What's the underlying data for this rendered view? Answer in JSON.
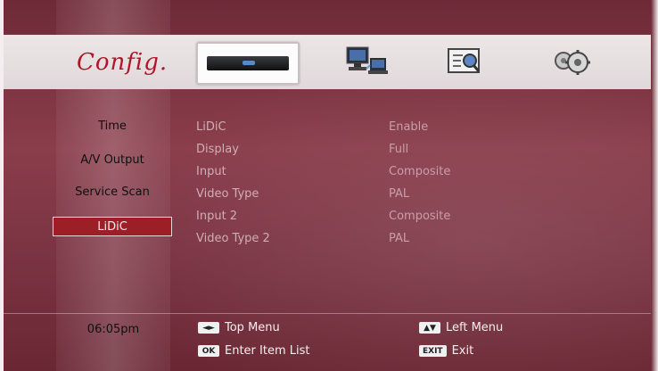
{
  "header": {
    "title": "Config.",
    "tabs": [
      {
        "name": "receiver",
        "icon": "receiver-icon"
      },
      {
        "name": "network",
        "icon": "network-computer-icon"
      },
      {
        "name": "information",
        "icon": "info-search-icon"
      },
      {
        "name": "settings",
        "icon": "gears-icon"
      }
    ]
  },
  "sidebar": {
    "items": [
      {
        "label": "Time"
      },
      {
        "label": "A/V Output"
      },
      {
        "label": "Service Scan"
      },
      {
        "label": "LiDiC",
        "selected": true
      }
    ]
  },
  "settings": [
    {
      "label": "LiDiC",
      "value": "Enable"
    },
    {
      "label": "Display",
      "value": "Full"
    },
    {
      "label": "Input",
      "value": "Composite"
    },
    {
      "label": "Video Type",
      "value": "PAL"
    },
    {
      "label": "Input 2",
      "value": "Composite"
    },
    {
      "label": "Video Type 2",
      "value": "PAL"
    }
  ],
  "footer": {
    "time": "06:05pm",
    "help": [
      {
        "key": "◄►",
        "label": "Top Menu"
      },
      {
        "key": "▲▼",
        "label": "Left Menu"
      },
      {
        "key": "OK",
        "label": "Enter Item List"
      },
      {
        "key": "EXIT",
        "label": "Exit"
      }
    ]
  },
  "colors": {
    "background": "#7a2f3d",
    "accent": "#b0162b",
    "selected": "#9c1f28"
  }
}
